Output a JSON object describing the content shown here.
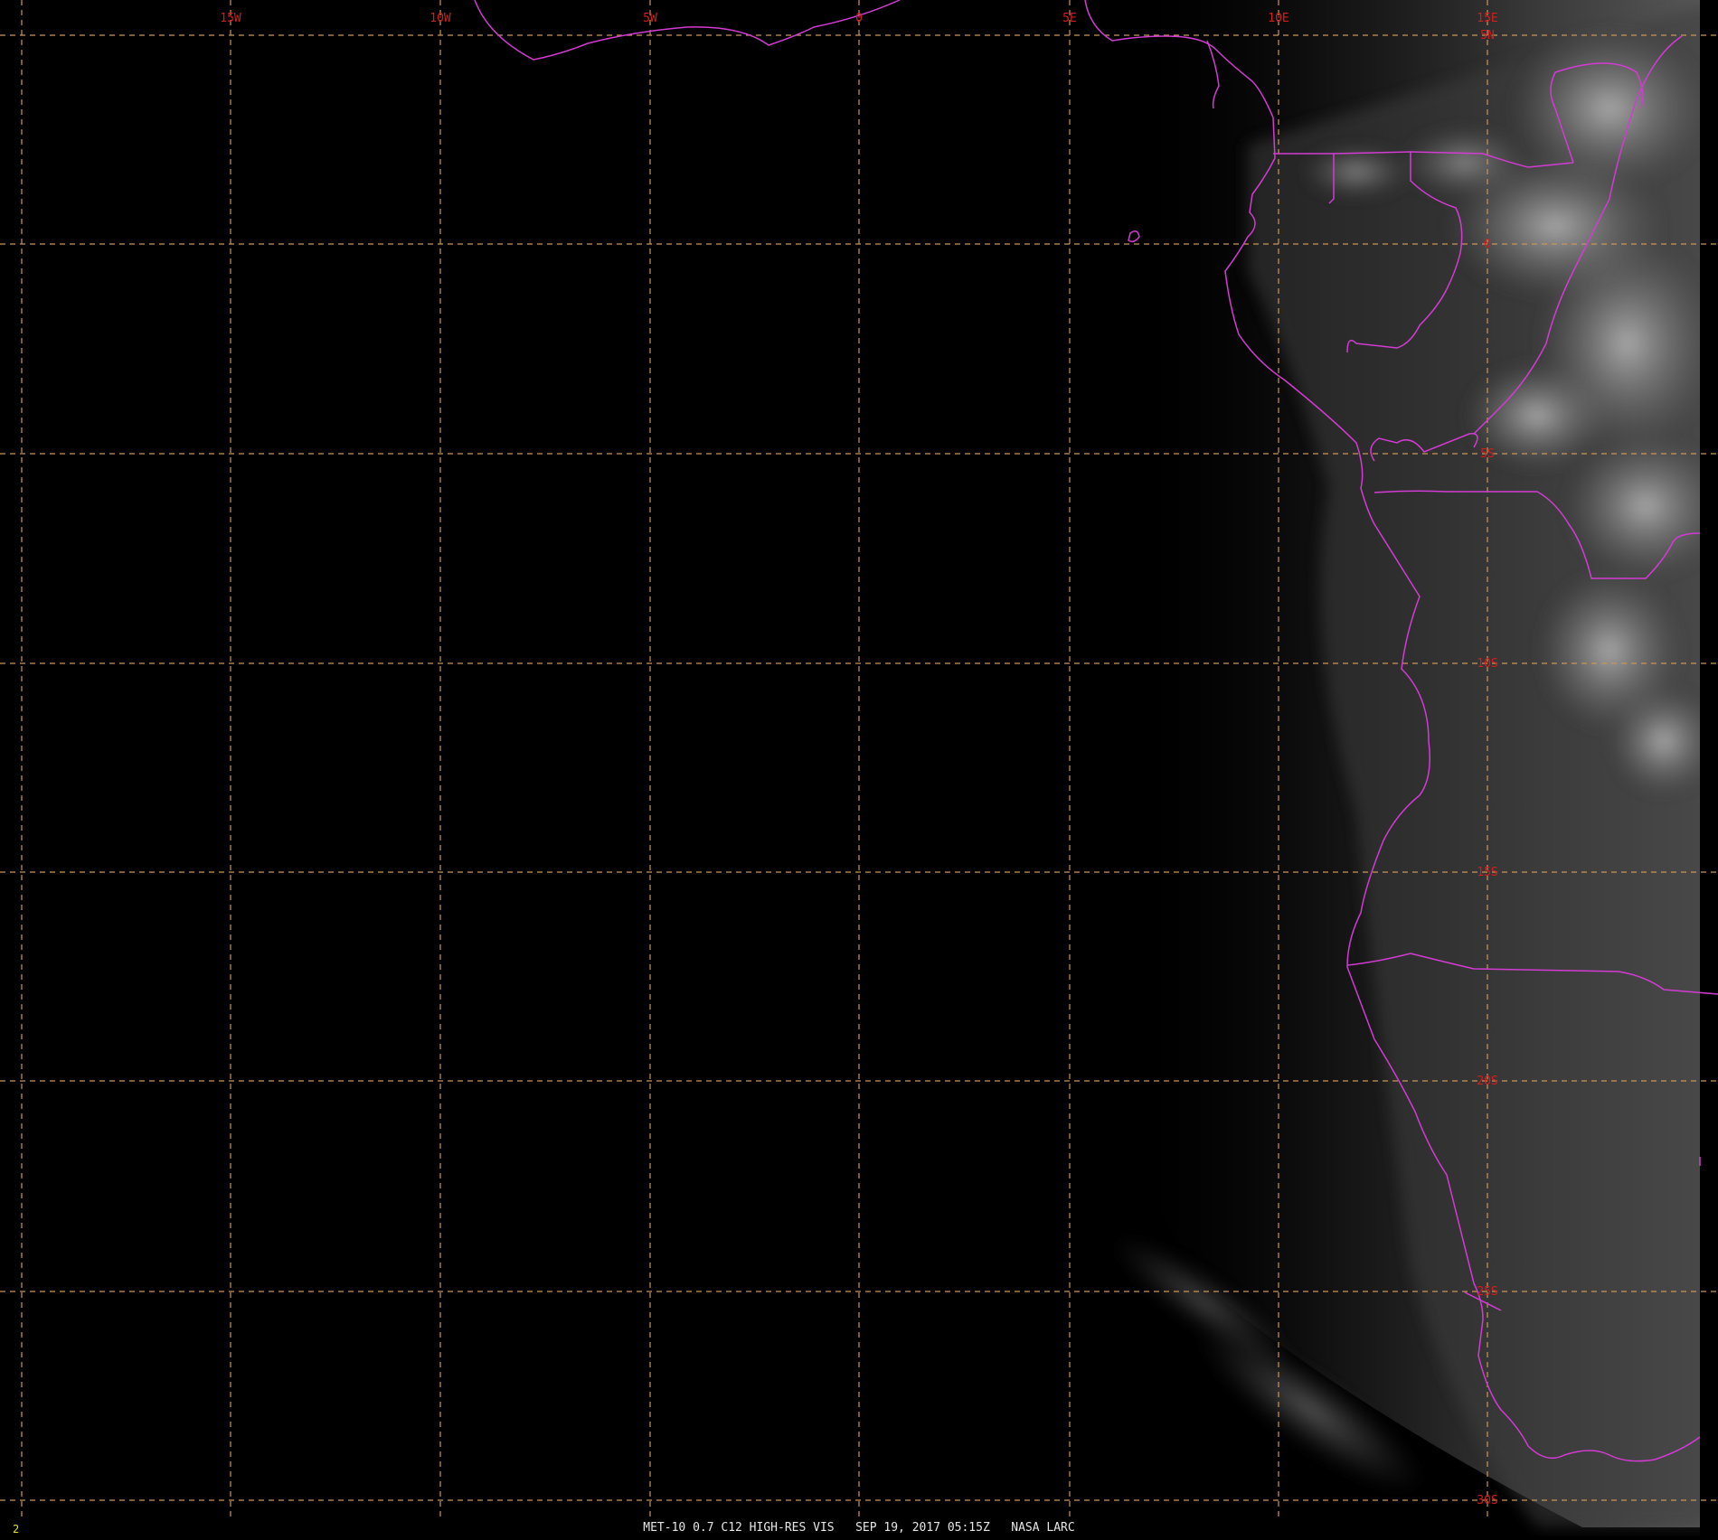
{
  "map": {
    "caption": "MET-10 0.7 C12 HIGH-RES VIS   SEP 19, 2017 05:15Z   NASA LARC",
    "frame_number": "2",
    "colors": {
      "background": "#000000",
      "grid": "#c8965a",
      "grid_label": "#d21e1e",
      "boundary": "#d23cd2",
      "caption": "#e6e6e6",
      "frame_number": "#e6e61e"
    },
    "longitude_labels": [
      "15W",
      "10W",
      "5W",
      "0",
      "5E",
      "10E",
      "15E"
    ],
    "latitude_labels": [
      "5N",
      "0",
      "5S",
      "10S",
      "15S",
      "20S",
      "25S",
      "30S"
    ],
    "layers": [
      "satellite-imagery",
      "lat-lon-grid",
      "political-boundaries",
      "coastlines"
    ]
  }
}
